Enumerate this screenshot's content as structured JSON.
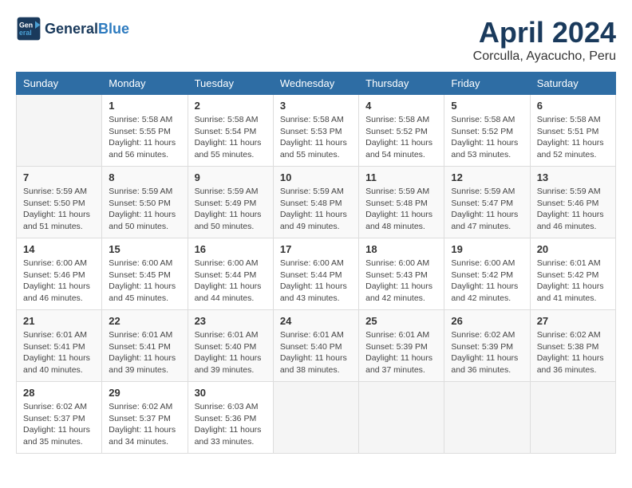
{
  "header": {
    "logo_line1": "General",
    "logo_line2": "Blue",
    "month": "April 2024",
    "location": "Corculla, Ayacucho, Peru"
  },
  "columns": [
    "Sunday",
    "Monday",
    "Tuesday",
    "Wednesday",
    "Thursday",
    "Friday",
    "Saturday"
  ],
  "weeks": [
    [
      {
        "day": "",
        "info": ""
      },
      {
        "day": "1",
        "info": "Sunrise: 5:58 AM\nSunset: 5:55 PM\nDaylight: 11 hours\nand 56 minutes."
      },
      {
        "day": "2",
        "info": "Sunrise: 5:58 AM\nSunset: 5:54 PM\nDaylight: 11 hours\nand 55 minutes."
      },
      {
        "day": "3",
        "info": "Sunrise: 5:58 AM\nSunset: 5:53 PM\nDaylight: 11 hours\nand 55 minutes."
      },
      {
        "day": "4",
        "info": "Sunrise: 5:58 AM\nSunset: 5:52 PM\nDaylight: 11 hours\nand 54 minutes."
      },
      {
        "day": "5",
        "info": "Sunrise: 5:58 AM\nSunset: 5:52 PM\nDaylight: 11 hours\nand 53 minutes."
      },
      {
        "day": "6",
        "info": "Sunrise: 5:58 AM\nSunset: 5:51 PM\nDaylight: 11 hours\nand 52 minutes."
      }
    ],
    [
      {
        "day": "7",
        "info": "Sunrise: 5:59 AM\nSunset: 5:50 PM\nDaylight: 11 hours\nand 51 minutes."
      },
      {
        "day": "8",
        "info": "Sunrise: 5:59 AM\nSunset: 5:50 PM\nDaylight: 11 hours\nand 50 minutes."
      },
      {
        "day": "9",
        "info": "Sunrise: 5:59 AM\nSunset: 5:49 PM\nDaylight: 11 hours\nand 50 minutes."
      },
      {
        "day": "10",
        "info": "Sunrise: 5:59 AM\nSunset: 5:48 PM\nDaylight: 11 hours\nand 49 minutes."
      },
      {
        "day": "11",
        "info": "Sunrise: 5:59 AM\nSunset: 5:48 PM\nDaylight: 11 hours\nand 48 minutes."
      },
      {
        "day": "12",
        "info": "Sunrise: 5:59 AM\nSunset: 5:47 PM\nDaylight: 11 hours\nand 47 minutes."
      },
      {
        "day": "13",
        "info": "Sunrise: 5:59 AM\nSunset: 5:46 PM\nDaylight: 11 hours\nand 46 minutes."
      }
    ],
    [
      {
        "day": "14",
        "info": "Sunrise: 6:00 AM\nSunset: 5:46 PM\nDaylight: 11 hours\nand 46 minutes."
      },
      {
        "day": "15",
        "info": "Sunrise: 6:00 AM\nSunset: 5:45 PM\nDaylight: 11 hours\nand 45 minutes."
      },
      {
        "day": "16",
        "info": "Sunrise: 6:00 AM\nSunset: 5:44 PM\nDaylight: 11 hours\nand 44 minutes."
      },
      {
        "day": "17",
        "info": "Sunrise: 6:00 AM\nSunset: 5:44 PM\nDaylight: 11 hours\nand 43 minutes."
      },
      {
        "day": "18",
        "info": "Sunrise: 6:00 AM\nSunset: 5:43 PM\nDaylight: 11 hours\nand 42 minutes."
      },
      {
        "day": "19",
        "info": "Sunrise: 6:00 AM\nSunset: 5:42 PM\nDaylight: 11 hours\nand 42 minutes."
      },
      {
        "day": "20",
        "info": "Sunrise: 6:01 AM\nSunset: 5:42 PM\nDaylight: 11 hours\nand 41 minutes."
      }
    ],
    [
      {
        "day": "21",
        "info": "Sunrise: 6:01 AM\nSunset: 5:41 PM\nDaylight: 11 hours\nand 40 minutes."
      },
      {
        "day": "22",
        "info": "Sunrise: 6:01 AM\nSunset: 5:41 PM\nDaylight: 11 hours\nand 39 minutes."
      },
      {
        "day": "23",
        "info": "Sunrise: 6:01 AM\nSunset: 5:40 PM\nDaylight: 11 hours\nand 39 minutes."
      },
      {
        "day": "24",
        "info": "Sunrise: 6:01 AM\nSunset: 5:40 PM\nDaylight: 11 hours\nand 38 minutes."
      },
      {
        "day": "25",
        "info": "Sunrise: 6:01 AM\nSunset: 5:39 PM\nDaylight: 11 hours\nand 37 minutes."
      },
      {
        "day": "26",
        "info": "Sunrise: 6:02 AM\nSunset: 5:39 PM\nDaylight: 11 hours\nand 36 minutes."
      },
      {
        "day": "27",
        "info": "Sunrise: 6:02 AM\nSunset: 5:38 PM\nDaylight: 11 hours\nand 36 minutes."
      }
    ],
    [
      {
        "day": "28",
        "info": "Sunrise: 6:02 AM\nSunset: 5:37 PM\nDaylight: 11 hours\nand 35 minutes."
      },
      {
        "day": "29",
        "info": "Sunrise: 6:02 AM\nSunset: 5:37 PM\nDaylight: 11 hours\nand 34 minutes."
      },
      {
        "day": "30",
        "info": "Sunrise: 6:03 AM\nSunset: 5:36 PM\nDaylight: 11 hours\nand 33 minutes."
      },
      {
        "day": "",
        "info": ""
      },
      {
        "day": "",
        "info": ""
      },
      {
        "day": "",
        "info": ""
      },
      {
        "day": "",
        "info": ""
      }
    ]
  ]
}
